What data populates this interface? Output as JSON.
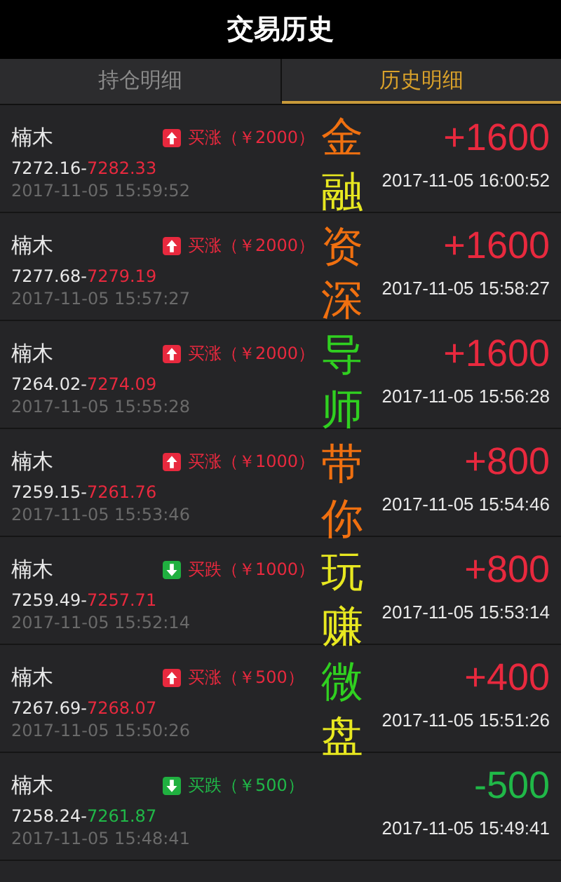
{
  "header": {
    "title": "交易历史"
  },
  "tabs": [
    {
      "label": "持仓明细",
      "selected": false
    },
    {
      "label": "历史明细",
      "selected": true
    }
  ],
  "trades": [
    {
      "name": "楠木",
      "rising": true,
      "win": true,
      "order": "买涨（￥2000）",
      "open_price": "7272.16-",
      "close_price": "7282.33",
      "open_time": "2017-11-05 15:59:52",
      "profit": "+1600",
      "close_time": "2017-11-05 16:00:52"
    },
    {
      "name": "楠木",
      "rising": true,
      "win": true,
      "order": "买涨（￥2000）",
      "open_price": "7277.68-",
      "close_price": "7279.19",
      "open_time": "2017-11-05 15:57:27",
      "profit": "+1600",
      "close_time": "2017-11-05 15:58:27"
    },
    {
      "name": "楠木",
      "rising": true,
      "win": true,
      "order": "买涨（￥2000）",
      "open_price": "7264.02-",
      "close_price": "7274.09",
      "open_time": "2017-11-05 15:55:28",
      "profit": "+1600",
      "close_time": "2017-11-05 15:56:28"
    },
    {
      "name": "楠木",
      "rising": true,
      "win": true,
      "order": "买涨（￥1000）",
      "open_price": "7259.15-",
      "close_price": "7261.76",
      "open_time": "2017-11-05 15:53:46",
      "profit": "+800",
      "close_time": "2017-11-05 15:54:46"
    },
    {
      "name": "楠木",
      "rising": false,
      "win": true,
      "order": "买跌（￥1000）",
      "open_price": "7259.49-",
      "close_price": "7257.71",
      "open_time": "2017-11-05 15:52:14",
      "profit": "+800",
      "close_time": "2017-11-05 15:53:14"
    },
    {
      "name": "楠木",
      "rising": true,
      "win": true,
      "order": "买涨（￥500）",
      "open_price": "7267.69-",
      "close_price": "7268.07",
      "open_time": "2017-11-05 15:50:26",
      "profit": "+400",
      "close_time": "2017-11-05 15:51:26"
    },
    {
      "name": "楠木",
      "rising": false,
      "win": false,
      "order": "买跌（￥500）",
      "open_price": "7258.24-",
      "close_price": "7261.87",
      "open_time": "2017-11-05 15:48:41",
      "profit": "-500",
      "close_time": "2017-11-05 15:49:41"
    }
  ],
  "overlay_text": [
    {
      "char": "金",
      "color": "#f07010"
    },
    {
      "char": "融",
      "color": "#e8e820"
    },
    {
      "char": "资",
      "color": "#f07010"
    },
    {
      "char": "深",
      "color": "#f07010"
    },
    {
      "char": "导",
      "color": "#30d020"
    },
    {
      "char": "师",
      "color": "#30d020"
    },
    {
      "char": "带",
      "color": "#f07010"
    },
    {
      "char": "你",
      "color": "#f07010"
    },
    {
      "char": "玩",
      "color": "#e8e820"
    },
    {
      "char": "赚",
      "color": "#e8e820"
    },
    {
      "char": "微",
      "color": "#30d020"
    },
    {
      "char": "盘",
      "color": "#e8e820"
    }
  ]
}
